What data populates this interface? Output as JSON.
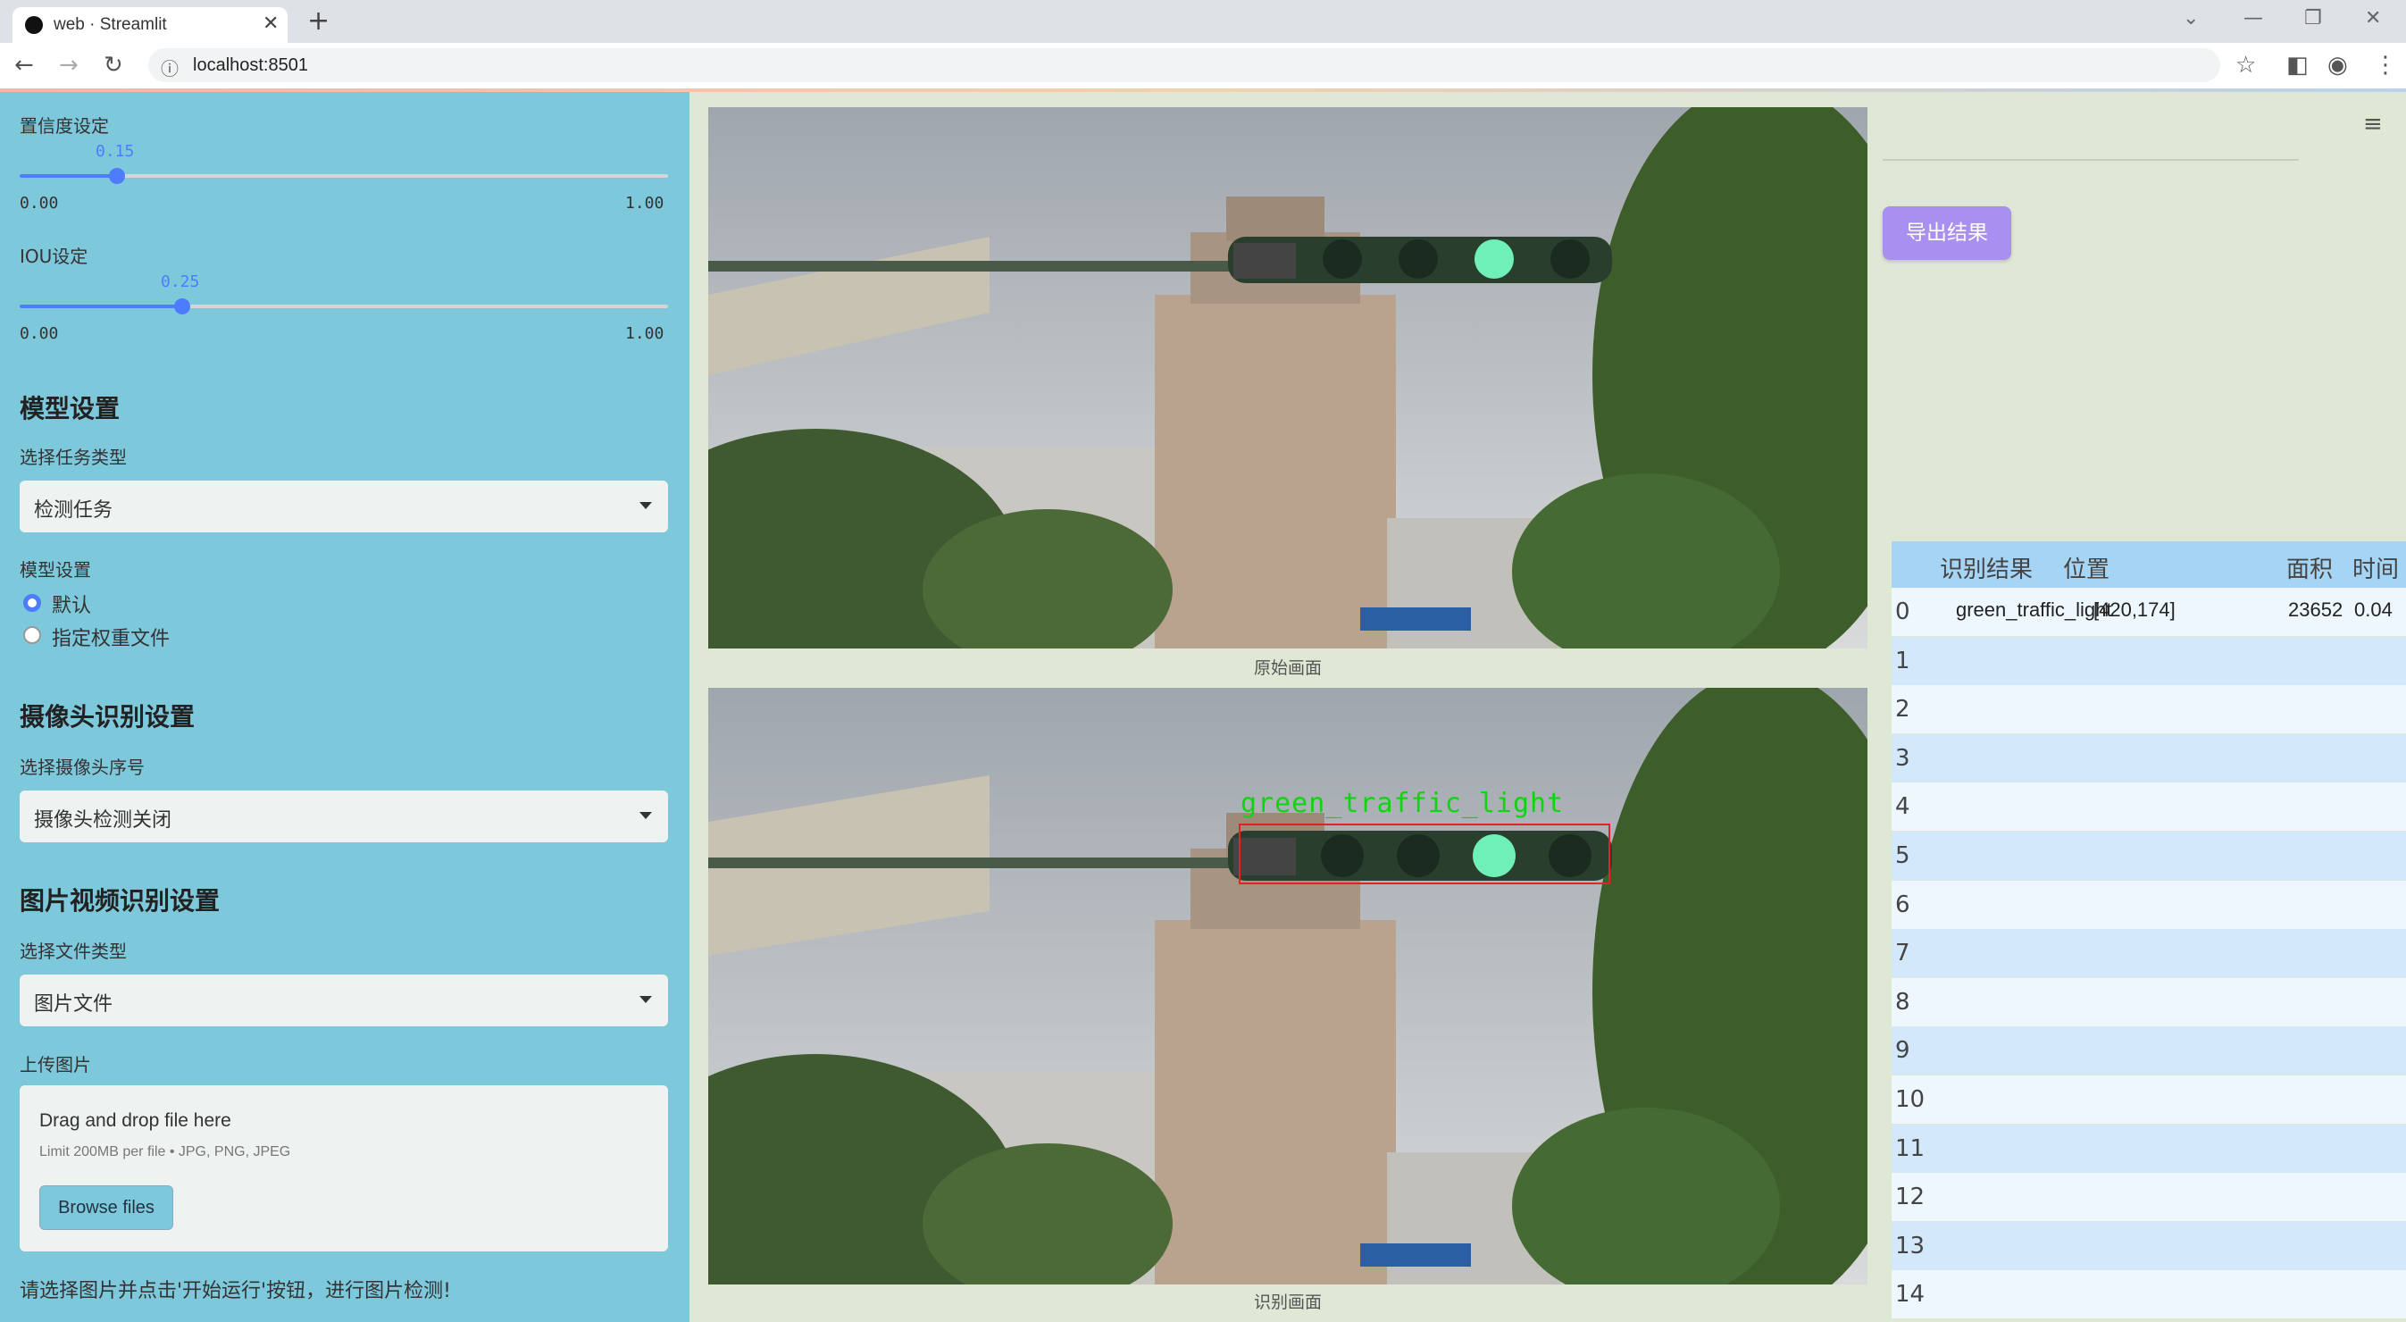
{
  "browser": {
    "tab_title": "web · Streamlit",
    "url": "localhost:8501"
  },
  "sidebar": {
    "confidence": {
      "label": "置信度设定",
      "value": "0.15",
      "fraction": 0.15,
      "min": "0.00",
      "max": "1.00"
    },
    "iou": {
      "label": "IOU设定",
      "value": "0.25",
      "fraction": 0.25,
      "min": "0.00",
      "max": "1.00"
    },
    "model_section": "模型设置",
    "task_type_label": "选择任务类型",
    "task_type_value": "检测任务",
    "model_settings_label": "模型设置",
    "model_options": [
      "默认",
      "指定权重文件"
    ],
    "model_selected": "默认",
    "camera_section": "摄像头识别设置",
    "camera_label": "选择摄像头序号",
    "camera_value": "摄像头检测关闭",
    "media_section": "图片视频识别设置",
    "file_type_label": "选择文件类型",
    "file_type_value": "图片文件",
    "upload_label": "上传图片",
    "upload_title": "Drag and drop file here",
    "upload_limit": "Limit 200MB per file • JPG, PNG, JPEG",
    "browse_label": "Browse files",
    "hint": "请选择图片并点击'开始运行'按钮，进行图片检测!"
  },
  "main": {
    "original_caption": "原始画面",
    "result_caption": "识别画面",
    "detection_label": "green_traffic_light"
  },
  "right": {
    "export_label": "导出结果",
    "table": {
      "headers": [
        "识别结果",
        "位置",
        "面积",
        "时间"
      ],
      "rows": [
        {
          "index": "0",
          "result": "green_traffic_light",
          "position": "[420,174]",
          "area": "23652",
          "time": "0.04"
        },
        {
          "index": "1"
        },
        {
          "index": "2"
        },
        {
          "index": "3"
        },
        {
          "index": "4"
        },
        {
          "index": "5"
        },
        {
          "index": "6"
        },
        {
          "index": "7"
        },
        {
          "index": "8"
        },
        {
          "index": "9"
        },
        {
          "index": "10"
        },
        {
          "index": "11"
        },
        {
          "index": "12"
        },
        {
          "index": "13"
        },
        {
          "index": "14"
        }
      ]
    }
  }
}
